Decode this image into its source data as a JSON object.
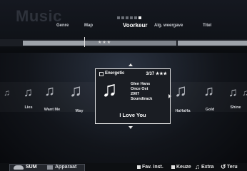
{
  "app": {
    "title": "Music"
  },
  "tabs": [
    {
      "label": "Genre",
      "active": false
    },
    {
      "label": "Map",
      "active": false
    },
    {
      "label": "Voorkeur",
      "active": true
    },
    {
      "label": "Alg. weergave",
      "active": false
    },
    {
      "label": "Titel",
      "active": false
    }
  ],
  "pagination": {
    "total": 6,
    "current": 6
  },
  "progress": {
    "stars": "★★★"
  },
  "carousel": {
    "left": [
      {
        "label": "Lies"
      },
      {
        "label": "Want Me"
      },
      {
        "label": "Way"
      }
    ],
    "right": [
      {
        "label": "HaHaHa"
      },
      {
        "label": "Gold"
      },
      {
        "label": "Shine"
      }
    ]
  },
  "selected": {
    "category": "Energetic",
    "rank": "3/37",
    "stars": "★★★",
    "artist": "Glen Hans",
    "album": "Once Ost",
    "year": "2007",
    "genre": "Soundtrack",
    "title": "I Love You"
  },
  "footer": {
    "sum_label": "SUM",
    "device_label": "Apparaat",
    "hints": [
      {
        "label": "Fav. inst.",
        "icon": "square-icon"
      },
      {
        "label": "Keuze",
        "icon": "square-icon"
      },
      {
        "label": "Extra",
        "icon": "music-note-icon"
      },
      {
        "label": "Teru",
        "icon": "return-icon"
      }
    ]
  }
}
